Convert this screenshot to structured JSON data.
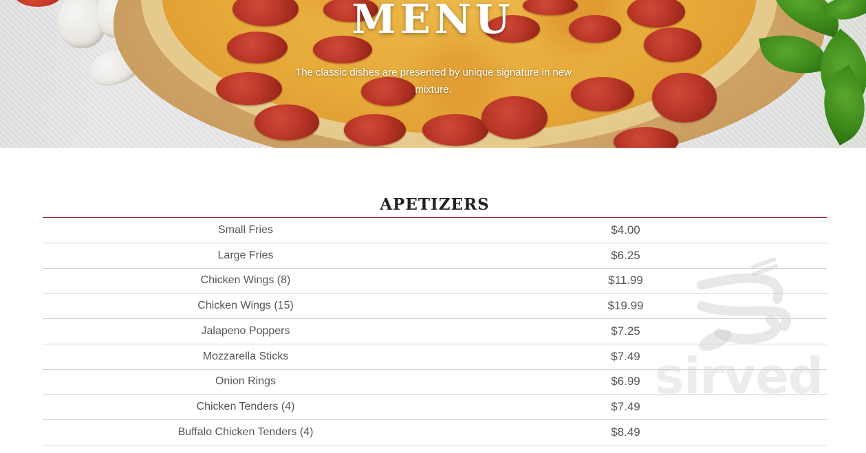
{
  "hero": {
    "title": "MENU",
    "subtitle": "The classic dishes are presented by unique signature in new mixture."
  },
  "section": {
    "title": "APETIZERS",
    "items": [
      {
        "name": "Small Fries",
        "price": "$4.00"
      },
      {
        "name": "Large Fries",
        "price": "$6.25"
      },
      {
        "name": "Chicken Wings (8)",
        "price": "$11.99"
      },
      {
        "name": "Chicken Wings (15)",
        "price": "$19.99"
      },
      {
        "name": "Jalapeno Poppers",
        "price": "$7.25"
      },
      {
        "name": "Mozzarella Sticks",
        "price": "$7.49"
      },
      {
        "name": "Onion Rings",
        "price": "$6.99"
      },
      {
        "name": "Chicken Tenders (4)",
        "price": "$7.49"
      },
      {
        "name": "Buffalo Chicken Tenders (4)",
        "price": "$8.49"
      }
    ]
  },
  "watermark": {
    "text": "sirved",
    "icon": "fork-knife-spoon-icon"
  },
  "colors": {
    "accent_rule": "#a31b1b",
    "row_divider": "#d4d4d4",
    "item_text": "#555555"
  }
}
